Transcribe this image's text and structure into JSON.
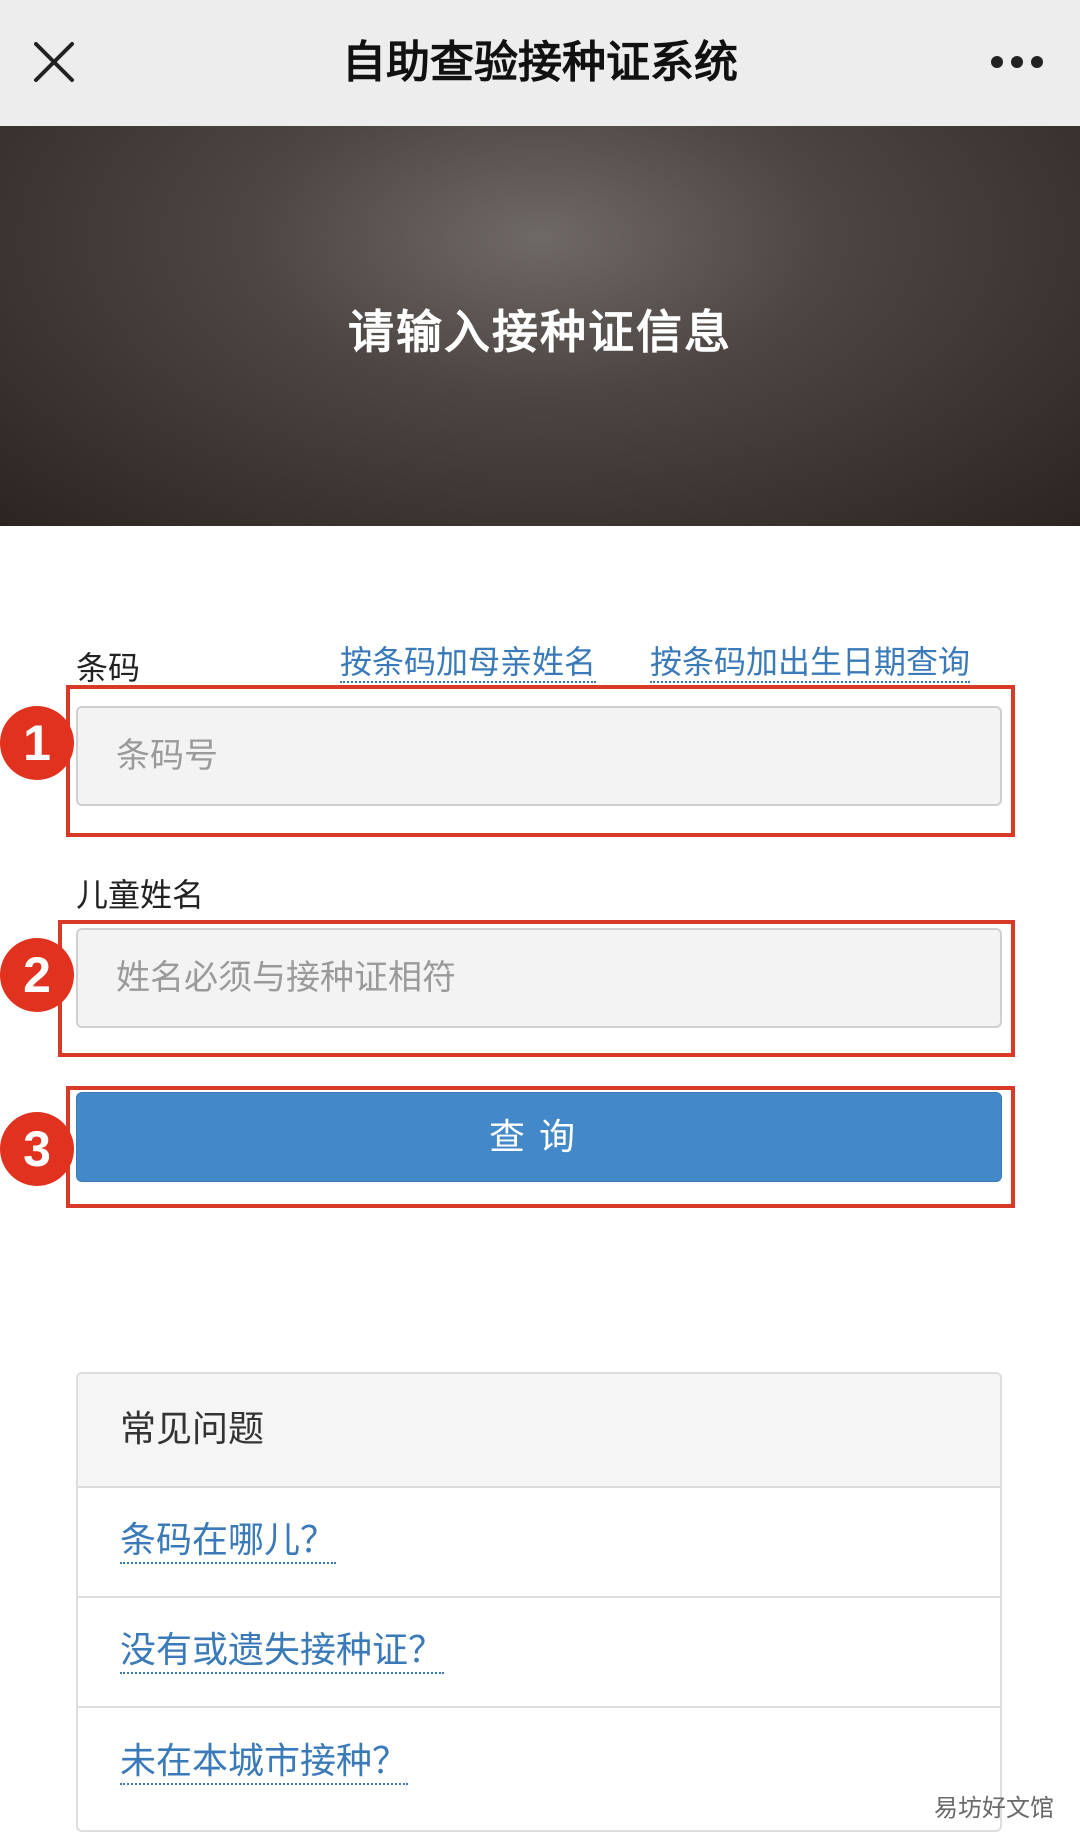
{
  "nav": {
    "title": "自助查验接种证系统",
    "close_icon": "close-icon",
    "more_icon": "more-dots-icon"
  },
  "banner": {
    "title": "请输入接种证信息"
  },
  "form": {
    "barcode_label": "条码",
    "link_mother_name": "按条码加母亲姓名",
    "link_birth_date": "按条码加出生日期查询",
    "barcode_placeholder": "条码号",
    "barcode_value": "",
    "child_name_label": "儿童姓名",
    "child_name_placeholder": "姓名必须与接种证相符",
    "child_name_value": "",
    "query_button": "查询"
  },
  "callouts": {
    "one": "1",
    "two": "2",
    "three": "3",
    "color": "#e0321e"
  },
  "faq": {
    "header": "常见问题",
    "items": [
      {
        "label": "条码在哪儿？"
      },
      {
        "label": "没有或遗失接种证？"
      },
      {
        "label": "未在本城市接种？"
      }
    ]
  },
  "watermark": "易坊好文馆",
  "colors": {
    "accent": "#4389c9",
    "link": "#3a7ab8",
    "callout": "#d93a28"
  }
}
